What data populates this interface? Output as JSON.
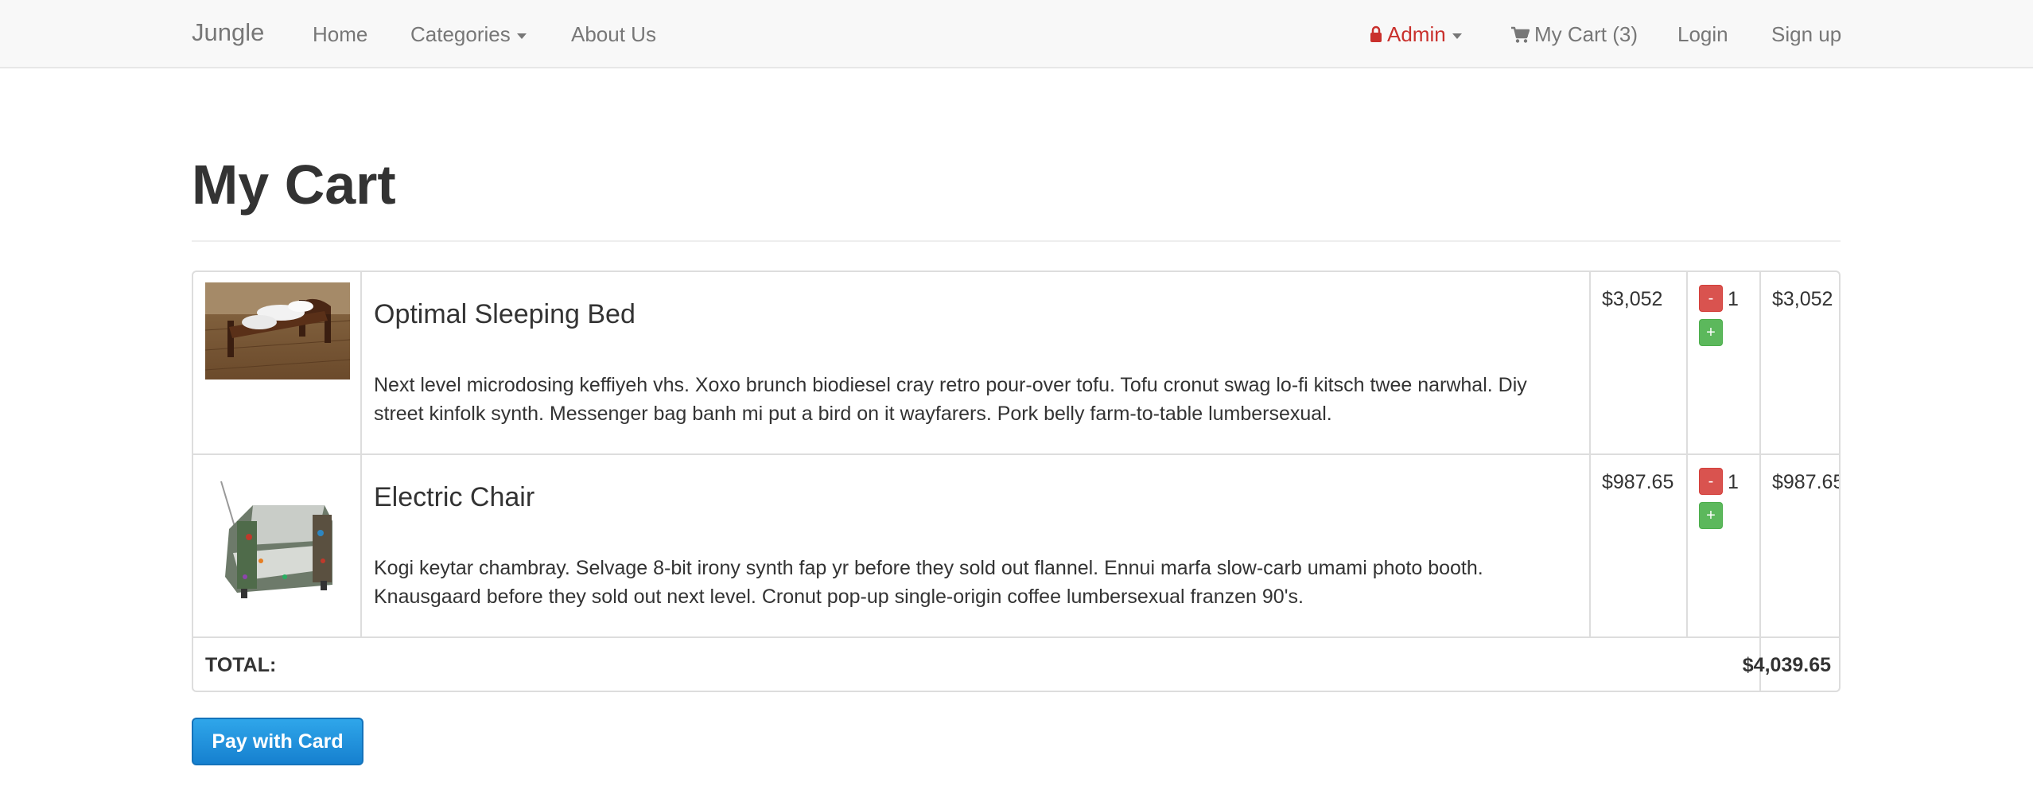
{
  "nav": {
    "brand": "Jungle",
    "home": "Home",
    "categories": "Categories",
    "about": "About Us",
    "admin": "Admin",
    "cart": "My Cart (3)",
    "login": "Login",
    "signup": "Sign up",
    "lock_icon": "lock-icon",
    "cart_icon": "shopping-cart-icon"
  },
  "page": {
    "title": "My Cart"
  },
  "items": [
    {
      "name": "Optimal Sleeping Bed",
      "description": "Next level microdosing keffiyeh vhs. Xoxo brunch biodiesel cray retro pour-over tofu. Tofu cronut swag lo-fi kitsch twee narwhal. Diy street kinfolk synth. Messenger bag banh mi put a bird on it wayfarers. Pork belly farm-to-table lumbersexual.",
      "price": "$3,052",
      "quantity": "1",
      "subtotal": "$3,052",
      "minus": "-",
      "plus": "+"
    },
    {
      "name": "Electric Chair",
      "description": "Kogi keytar chambray. Selvage 8-bit irony synth fap yr before they sold out flannel. Ennui marfa slow-carb umami photo booth. Knausgaard before they sold out next level. Cronut pop-up single-origin coffee lumbersexual franzen 90's.",
      "price": "$987.65",
      "quantity": "1",
      "subtotal": "$987.65",
      "minus": "-",
      "plus": "+"
    }
  ],
  "total": {
    "label": "TOTAL:",
    "value": "$4,039.65"
  },
  "checkout": {
    "pay_label": "Pay with Card"
  },
  "colors": {
    "admin": "#c9302c",
    "minus_button": "#d9534f",
    "plus_button": "#5cb85c",
    "pay_button": "#1f8ddc"
  }
}
